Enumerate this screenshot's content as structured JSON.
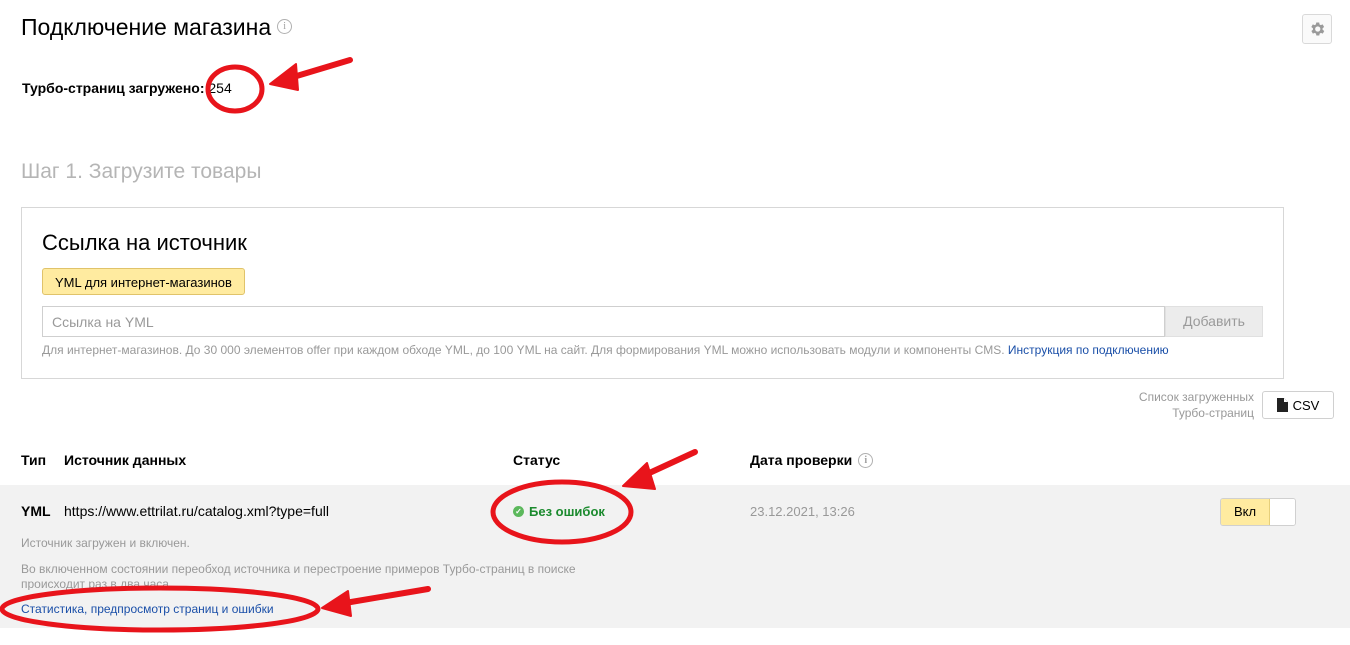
{
  "header": {
    "title": "Подключение магазина",
    "info_glyph": "i",
    "settings_icon": "gear-icon"
  },
  "counter": {
    "label": "Турбо-страниц загружено:",
    "value": "254"
  },
  "step": {
    "title": "Шаг 1. Загрузите товары"
  },
  "source": {
    "title": "Ссылка на источник",
    "tab_label": "YML для интернет-магазинов",
    "input_placeholder": "Ссылка на YML",
    "input_value": "",
    "add_button": "Добавить",
    "hint_text": "Для интернет-магазинов. До 30 000 элементов offer при каждом обходе YML, до 100 YML на сайт. Для формирования YML можно использовать модули и компоненты CMS.",
    "hint_link": "Инструкция по подключению"
  },
  "csv": {
    "label_line1": "Список загруженных",
    "label_line2": "Турбо-страниц",
    "button": "CSV"
  },
  "table": {
    "headers": {
      "type": "Тип",
      "source": "Источник данных",
      "status": "Статус",
      "date": "Дата проверки"
    },
    "row": {
      "type": "YML",
      "url": "https://www.ettrilat.ru/catalog.xml?type=full",
      "status": "Без ошибок",
      "date": "23.12.2021, 13:26",
      "toggle_label": "Вкл",
      "note1": "Источник загружен и включен.",
      "note2": "Во включенном состоянии переобход источника и перестроение примеров Турбо-страниц в поиске происходит раз в два часа.",
      "link": "Статистика, предпросмотр страниц и ошибки"
    }
  },
  "colors": {
    "accent_yellow": "#ffeba0",
    "link_blue": "#1a4fa8",
    "status_green": "#1b8a2e",
    "annotation_red": "#e8141b"
  }
}
